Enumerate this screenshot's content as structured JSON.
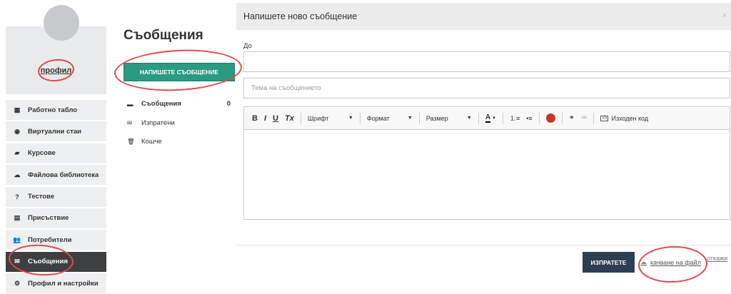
{
  "sidebar": {
    "profile_label": "профил",
    "items": [
      {
        "label": "Работно табло",
        "icon": "dashboard-icon",
        "glyph": "▦",
        "active": false
      },
      {
        "label": "Виртуални стаи",
        "icon": "play-circle-icon",
        "glyph": "◉",
        "active": false
      },
      {
        "label": "Курсове",
        "icon": "book-icon",
        "glyph": "▰",
        "active": false
      },
      {
        "label": "Файлова библиотека",
        "icon": "cloud-icon",
        "glyph": "☁",
        "active": false
      },
      {
        "label": "Тестове",
        "icon": "question-circle-icon",
        "glyph": "?",
        "active": false
      },
      {
        "label": "Присъствие",
        "icon": "document-icon",
        "glyph": "▤",
        "active": false
      },
      {
        "label": "Потребители",
        "icon": "users-icon",
        "glyph": "👥",
        "active": false
      },
      {
        "label": "Съобщения",
        "icon": "envelope-icon",
        "glyph": "✉",
        "active": true
      },
      {
        "label": "Профил и настройки",
        "icon": "gear-icon",
        "glyph": "⚙",
        "active": false
      }
    ]
  },
  "messages": {
    "title": "Съобщения",
    "compose_label": "НАПИШЕТЕ СЪОБЩЕНИЕ",
    "folders": [
      {
        "label": "Съобщения",
        "icon": "inbox-icon",
        "glyph": "▬",
        "count": "0",
        "bold": true
      },
      {
        "label": "Изпратени",
        "icon": "envelope-icon",
        "glyph": "✉",
        "count": "",
        "bold": false
      },
      {
        "label": "Кошче",
        "icon": "trash-icon",
        "glyph": "🗑",
        "count": "",
        "bold": false
      }
    ]
  },
  "modal": {
    "title": "Напишете ново съобщение",
    "close": "×",
    "to_label": "До",
    "subject_placeholder": "Тема на съобщението",
    "toolbar": {
      "bold": "B",
      "italic": "I",
      "underline": "U",
      "clear_format": "Tx",
      "font": "Шрифт",
      "format": "Формат",
      "size": "Размер",
      "text_color": "A",
      "source": "Изходен код"
    },
    "send_label": "ИЗПРАТЕТЕ",
    "upload_label": "качване на файл",
    "cancel_label": "откажи"
  },
  "colors": {
    "compose_button": "#2a9a80",
    "send_button": "#2d3e50",
    "active_nav": "#3e3f41",
    "annotation": "#e04a4a"
  }
}
